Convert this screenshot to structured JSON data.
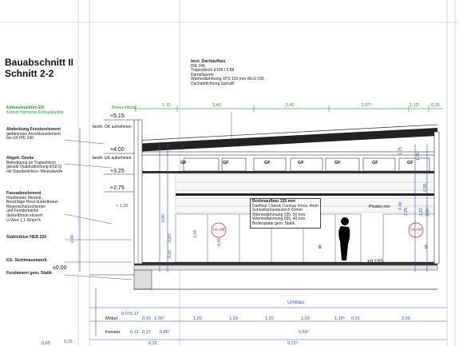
{
  "title": {
    "line1": "Bauabschnitt II",
    "line2": "Schnitt 2-2"
  },
  "notes": {
    "dachaufbau": {
      "heading": "best. Dachaufbau",
      "lines": [
        "IPE 240",
        "Trapezblech  E106 / 0.88",
        "Dampfsperre",
        "Wärmedämmung XPS 150 mm WLG 035",
        "Dachabdichtung Sarnafil"
      ]
    },
    "einbauleuchten": {
      "heading": "Einbauleuchten ED",
      "lines": [
        "Kobold Harmonie Einbauleuchte"
      ]
    },
    "beleuchtung": "Beleuchtung",
    "abdeckung": {
      "heading": "Abdeckung Fensterelement",
      "lines": [
        "gedämmtes Anschlusselement",
        "bis UK IPE 240"
      ]
    },
    "decke": {
      "heading": "Abgeh. Decke",
      "lines": [
        "Befestigung an Trapezblech",
        "gerade Quadratlochung 8/18 Q",
        "mit Standardvlies+ Mineralwolle"
      ]
    },
    "fassade": {
      "heading": "Fassadenelement",
      "lines": [
        "Holzfenster Meranti,",
        "Beschläge Hewi dunkelbraun",
        "Regenschutzschienen",
        "und Fensterbänke",
        "dunkelbraun eloxiert",
        "U-Wert 1,1 W/qm*k"
      ]
    },
    "stahlstuetze": "Stahlstütze HEB 220",
    "ks": "KS- Sichtmauerwerk",
    "fundament": "Fundament gem. Statik",
    "bodenaufbau": {
      "heading": "Bodenaufbau 155 mm",
      "lines": [
        "Danfloor Classic Contrac hmca. 4mm",
        "Schnellzementestrich 60mm",
        "Wärmedämmung 035, 50 mm",
        "Wärmedämmung 035, 40 mm",
        "Bodenplatte gem. Statik"
      ]
    },
    "pfosten": "Pfosten mm",
    "ok_aufheben_1": "besth. OK aufnehmen",
    "ok_aufheben_2": "besth. UK aufnehmen"
  },
  "levels": {
    "l1": "+5.15",
    "l2": "+4.00",
    "l3": "+3.25",
    "l4": "+2.75",
    "l5": "±0.00",
    "l6": "±0.155",
    "l7": "+ 1,29"
  },
  "gf_label": "GF",
  "ilm_label": "I+L+M",
  "marks": {
    "m6": "6",
    "m5": "5"
  },
  "top_dims": [
    "1,10",
    "2,40",
    "2,40",
    "2,57⁵",
    "1,12⁵",
    "0,29"
  ],
  "umbau": "Umbau",
  "rows": {
    "moebel": {
      "label": "Möbel",
      "values": [
        "0,07",
        "0,17",
        "0,10",
        "1,00⁵",
        "1,20",
        "1,20",
        "1,20",
        "1,20",
        "1,10⁵",
        "0,01",
        "2,30"
      ]
    },
    "fenster": {
      "label": "Fenster",
      "values": [
        "0,12",
        "0,17",
        "0,86⁵",
        "6,69⁵"
      ]
    },
    "bottom": {
      "values": [
        "0,63",
        "0,15",
        "0,22",
        "9,72⁵"
      ]
    }
  },
  "vertical_dims": [
    "1,75",
    "1,76⁵",
    "0,49",
    "3,25",
    "2,87",
    "0,28",
    "3,86⁵",
    "0,60",
    "0,80",
    "0,20",
    "1,44",
    "0,42",
    "2,49"
  ]
}
